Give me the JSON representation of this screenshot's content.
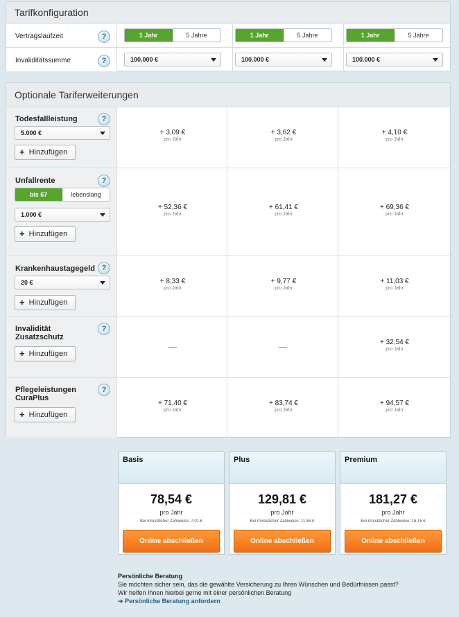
{
  "config": {
    "title": "Tarifkonfiguration",
    "rows": {
      "vertragslaufzeit": {
        "label": "Vertragslaufzeit",
        "option_on": "1 Jahr",
        "option_off": "5 Jahre"
      },
      "invaliditaetssumme": {
        "label": "Invaliditätssumme",
        "value": "100.000 €"
      }
    }
  },
  "help_label": "?",
  "options": {
    "title": "Optionale Tariferweiterungen",
    "add_label": "Hinzufügen",
    "add_icon": "+",
    "per_year": "pro Jahr",
    "dash": "—",
    "rows": [
      {
        "label_1": "Todesfallleistung",
        "label_2": "",
        "select": "5.000 €",
        "prices": [
          "+ 3,09 €",
          "+ 3,62 €",
          "+ 4,10 €"
        ]
      },
      {
        "label_1": "Unfallrente",
        "label_2": "",
        "seg_on": "bis 67",
        "seg_off": "lebenslang",
        "select": "1.000 €",
        "prices": [
          "+ 52,36 €",
          "+ 61,41 €",
          "+ 69,36 €"
        ]
      },
      {
        "label_1": "Krankenhaustagegeld",
        "label_2": "",
        "select": "20 €",
        "prices": [
          "+ 8,33 €",
          "+ 9,77 €",
          "+ 11,03 €"
        ]
      },
      {
        "label_1": "Invalidität",
        "label_2": "Zusatzschutz",
        "prices": [
          "",
          "",
          "+ 32,54 €"
        ]
      },
      {
        "label_1": "Pflegeleistungen",
        "label_2": "CuraPlus",
        "prices": [
          "+ 71,40 €",
          "+ 83,74 €",
          "+ 94,57 €"
        ]
      }
    ]
  },
  "plans": [
    {
      "name": "Basis",
      "price": "78,54 €",
      "per": "pro Jahr",
      "monthly": "Bei monatlicher Zahlweise: 7,01 €",
      "cta": "Online abschließen"
    },
    {
      "name": "Plus",
      "price": "129,81 €",
      "per": "pro Jahr",
      "monthly": "Bei monatlicher Zahlweise: 11,58 €",
      "cta": "Online abschließen"
    },
    {
      "name": "Premium",
      "price": "181,27 €",
      "per": "pro Jahr",
      "monthly": "Bei monatlicher Zahlweise: 16,16 €",
      "cta": "Online abschließen"
    }
  ],
  "advice": {
    "title": "Persönliche Beratung",
    "line1": "Sie möchten sicher sein, das die gewählte Versicherung zu Ihren Wünschen und Bedürfnissen passt?",
    "line2": "Wir helfen Ihnen hierbei gerne mit einer persönlichen Beratung",
    "link_arrow": "➔",
    "link": "Persönliche Beratung anfordern"
  }
}
